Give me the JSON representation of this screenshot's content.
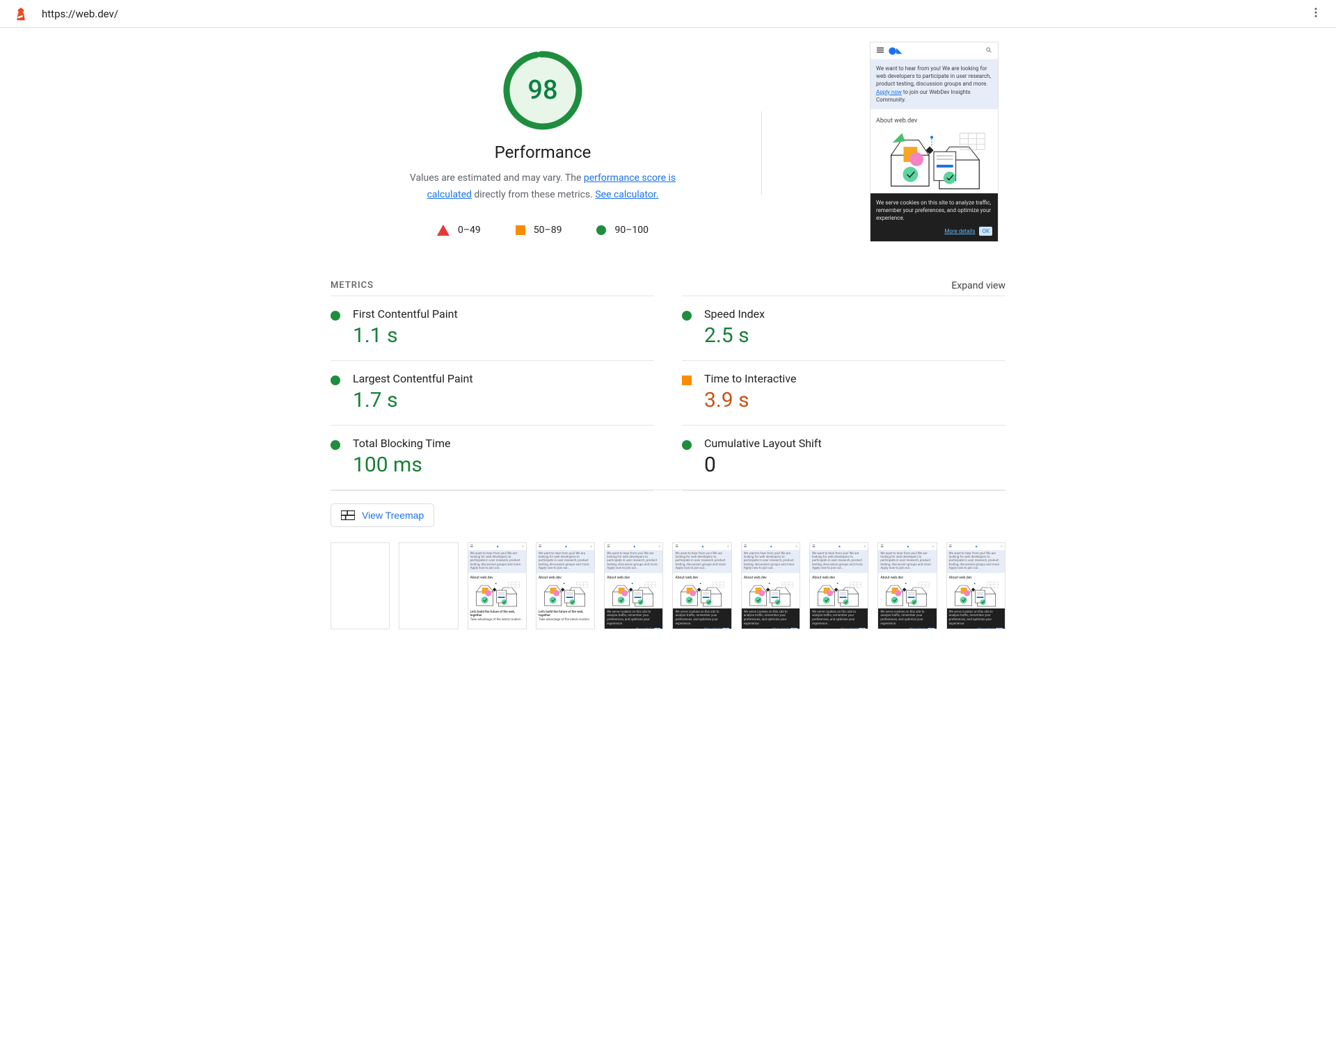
{
  "header": {
    "url": "https://web.dev/"
  },
  "gauge": {
    "score": "98",
    "label": "Performance",
    "desc_prefix": "Values are estimated and may vary. The ",
    "link1": "performance score is calculated",
    "desc_mid": " directly from these metrics. ",
    "link2": "See calculator."
  },
  "legend": {
    "range_fail": "0–49",
    "range_avg": "50–89",
    "range_pass": "90–100"
  },
  "preview": {
    "banner_text": "We want to hear from you! We are looking for web developers to participate in user research, product testing, discussion groups and more. ",
    "banner_link": "Apply now",
    "banner_suffix": " to join our WebDev Insights Community.",
    "about": "About web.dev",
    "cookie_text": "We serve cookies on this site to analyze traffic, remember your preferences, and optimize your experience.",
    "more_details": "More details",
    "ok": "OK"
  },
  "metrics": {
    "title": "METRICS",
    "expand": "Expand view",
    "items": [
      {
        "name": "First Contentful Paint",
        "value": "1.1 s",
        "status": "green"
      },
      {
        "name": "Speed Index",
        "value": "2.5 s",
        "status": "green"
      },
      {
        "name": "Largest Contentful Paint",
        "value": "1.7 s",
        "status": "green"
      },
      {
        "name": "Time to Interactive",
        "value": "3.9 s",
        "status": "orange"
      },
      {
        "name": "Total Blocking Time",
        "value": "100 ms",
        "status": "green"
      },
      {
        "name": "Cumulative Layout Shift",
        "value": "0",
        "status": "green",
        "color": "dark"
      }
    ]
  },
  "treemap": {
    "label": "View Treemap"
  },
  "filmstrip": {
    "footer_light_line1": "Let's build the future of the web, together",
    "footer_light_line2": "Take advantage of the latest modern"
  }
}
